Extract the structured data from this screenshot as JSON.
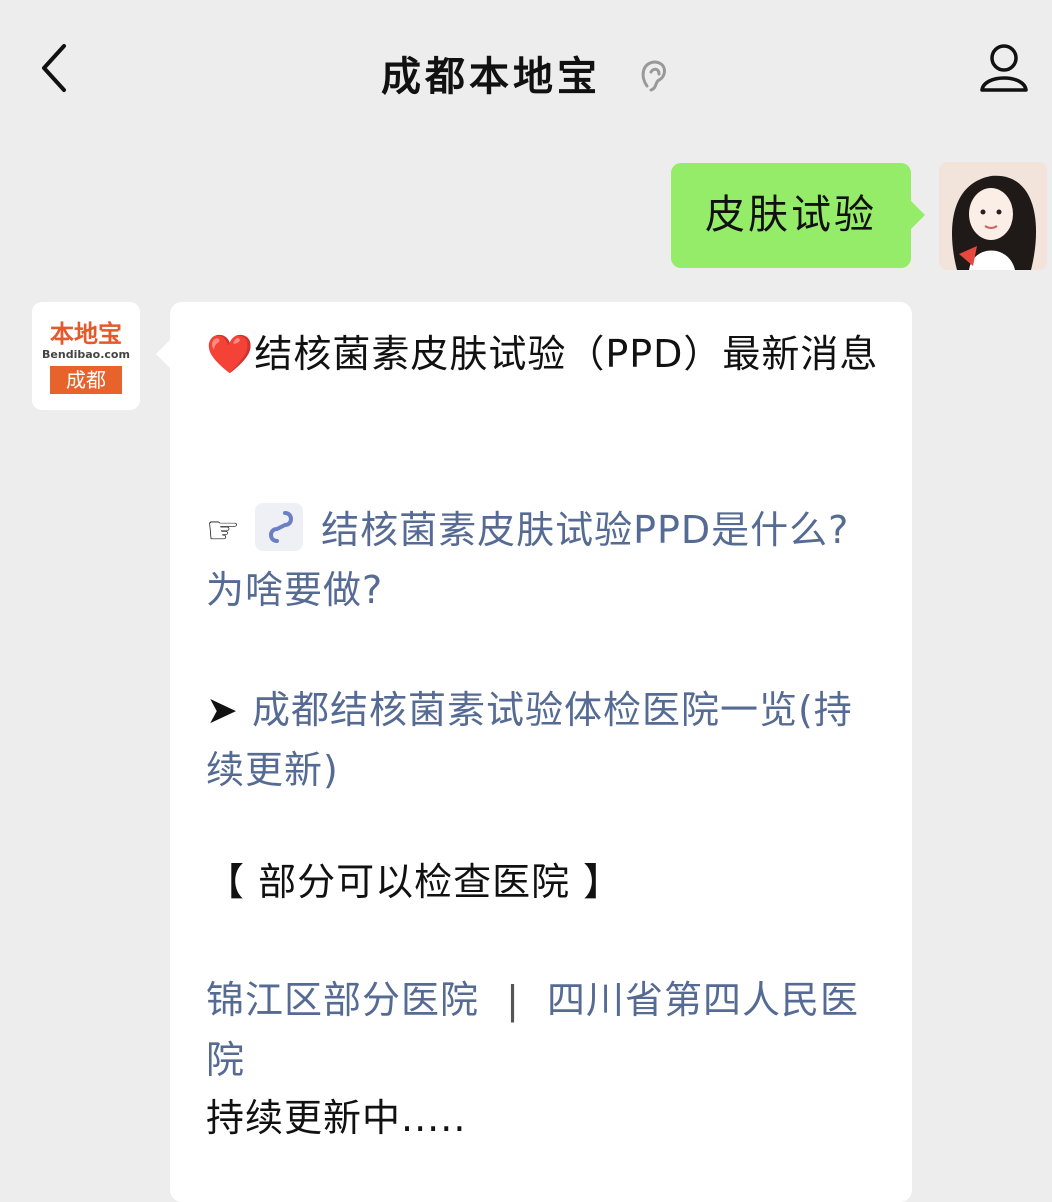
{
  "header": {
    "title": "成都本地宝"
  },
  "user_message": {
    "text": "皮肤试验"
  },
  "bot_avatar": {
    "logo_text": "本地宝",
    "logo_sub": "Bendibao.com",
    "city": "成都"
  },
  "bot_message": {
    "heart": "❤️",
    "headline": "结核菌素皮肤试验（PPD）最新消息",
    "link1_prefix": "☞",
    "link1_text": "结核菌素皮肤试验PPD是什么?为啥要做?",
    "link2_prefix": "➤",
    "link2_text": "成都结核菌素试验体检医院一览(持续更新)",
    "section_header": "【 部分可以检查医院 】",
    "hospital_link_1": "锦江区部分医院",
    "separator": "|",
    "hospital_link_2": "四川省第四人民医院",
    "footer_text": "持续更新中....."
  },
  "colors": {
    "background": "#ededed",
    "user_bubble": "#95ec69",
    "link": "#566b94"
  }
}
